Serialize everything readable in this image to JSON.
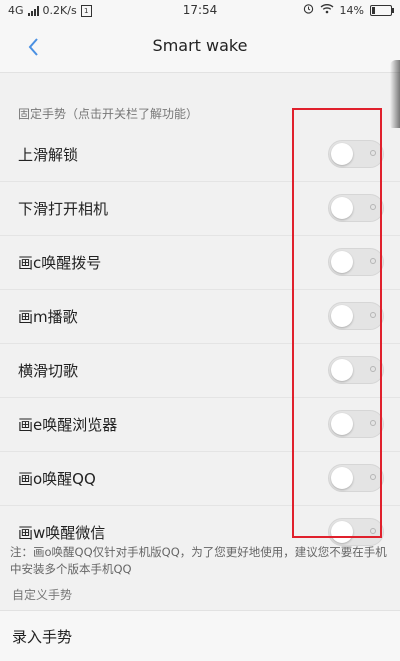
{
  "status_bar": {
    "network": "4G",
    "speed": "0.2K/s",
    "sim_label": "1",
    "time": "17:54",
    "battery": "14%",
    "battery_level": 0.14
  },
  "nav": {
    "title": "Smart wake"
  },
  "fixed_gestures": {
    "header": "固定手势（点击开关栏了解功能）",
    "items": [
      {
        "label": "上滑解锁",
        "on": false
      },
      {
        "label": "下滑打开相机",
        "on": false
      },
      {
        "label": "画c唤醒拨号",
        "on": false
      },
      {
        "label": "画m播歌",
        "on": false
      },
      {
        "label": "横滑切歌",
        "on": false
      },
      {
        "label": "画e唤醒浏览器",
        "on": false
      },
      {
        "label": "画o唤醒QQ",
        "on": false
      },
      {
        "label": "画w唤醒微信",
        "on": false
      }
    ]
  },
  "note": "注：画o唤醒QQ仅针对手机版QQ，为了您更好地使用，建议您不要在手机中安装多个版本手机QQ",
  "custom_gestures": {
    "header": "自定义手势",
    "record_label": "录入手势"
  },
  "colors": {
    "highlight": "#e0202c",
    "accent": "#4a90e2"
  }
}
